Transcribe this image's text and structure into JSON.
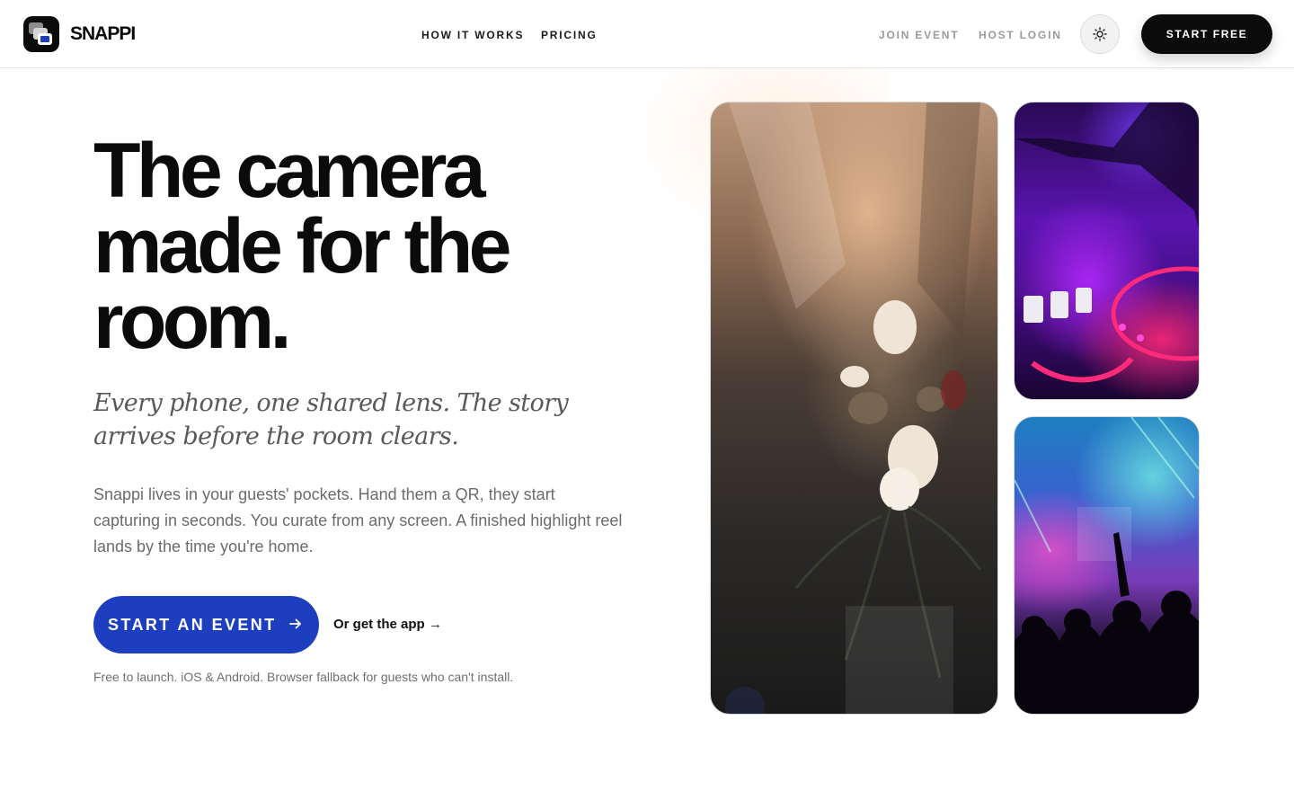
{
  "nav": {
    "brand": "SNAPPI",
    "links": [
      "HOW IT WORKS",
      "PRICING"
    ],
    "join_event": "JOIN EVENT",
    "host_login": "HOST LOGIN",
    "theme_icon": "sun-icon",
    "start_free": "START FREE"
  },
  "hero": {
    "headline_lines": [
      "The camera",
      "made for the",
      "room."
    ],
    "subhead": "Every phone, one shared lens. The story arrives before the room clears.",
    "body": "Snappi lives in your guests' pockets. Hand them a QR, they start capturing in seconds. You curate from any screen. A finished highlight reel lands by the time you're home.",
    "cta_primary": "START AN EVENT",
    "cta_secondary": "Or get the app →",
    "fineprint": "Free to launch. iOS & Android. Browser fallback for guests who can't install."
  },
  "colors": {
    "accent": "#1d3fbf",
    "ink": "#0b0b0b",
    "muted": "#9a9a9a"
  }
}
